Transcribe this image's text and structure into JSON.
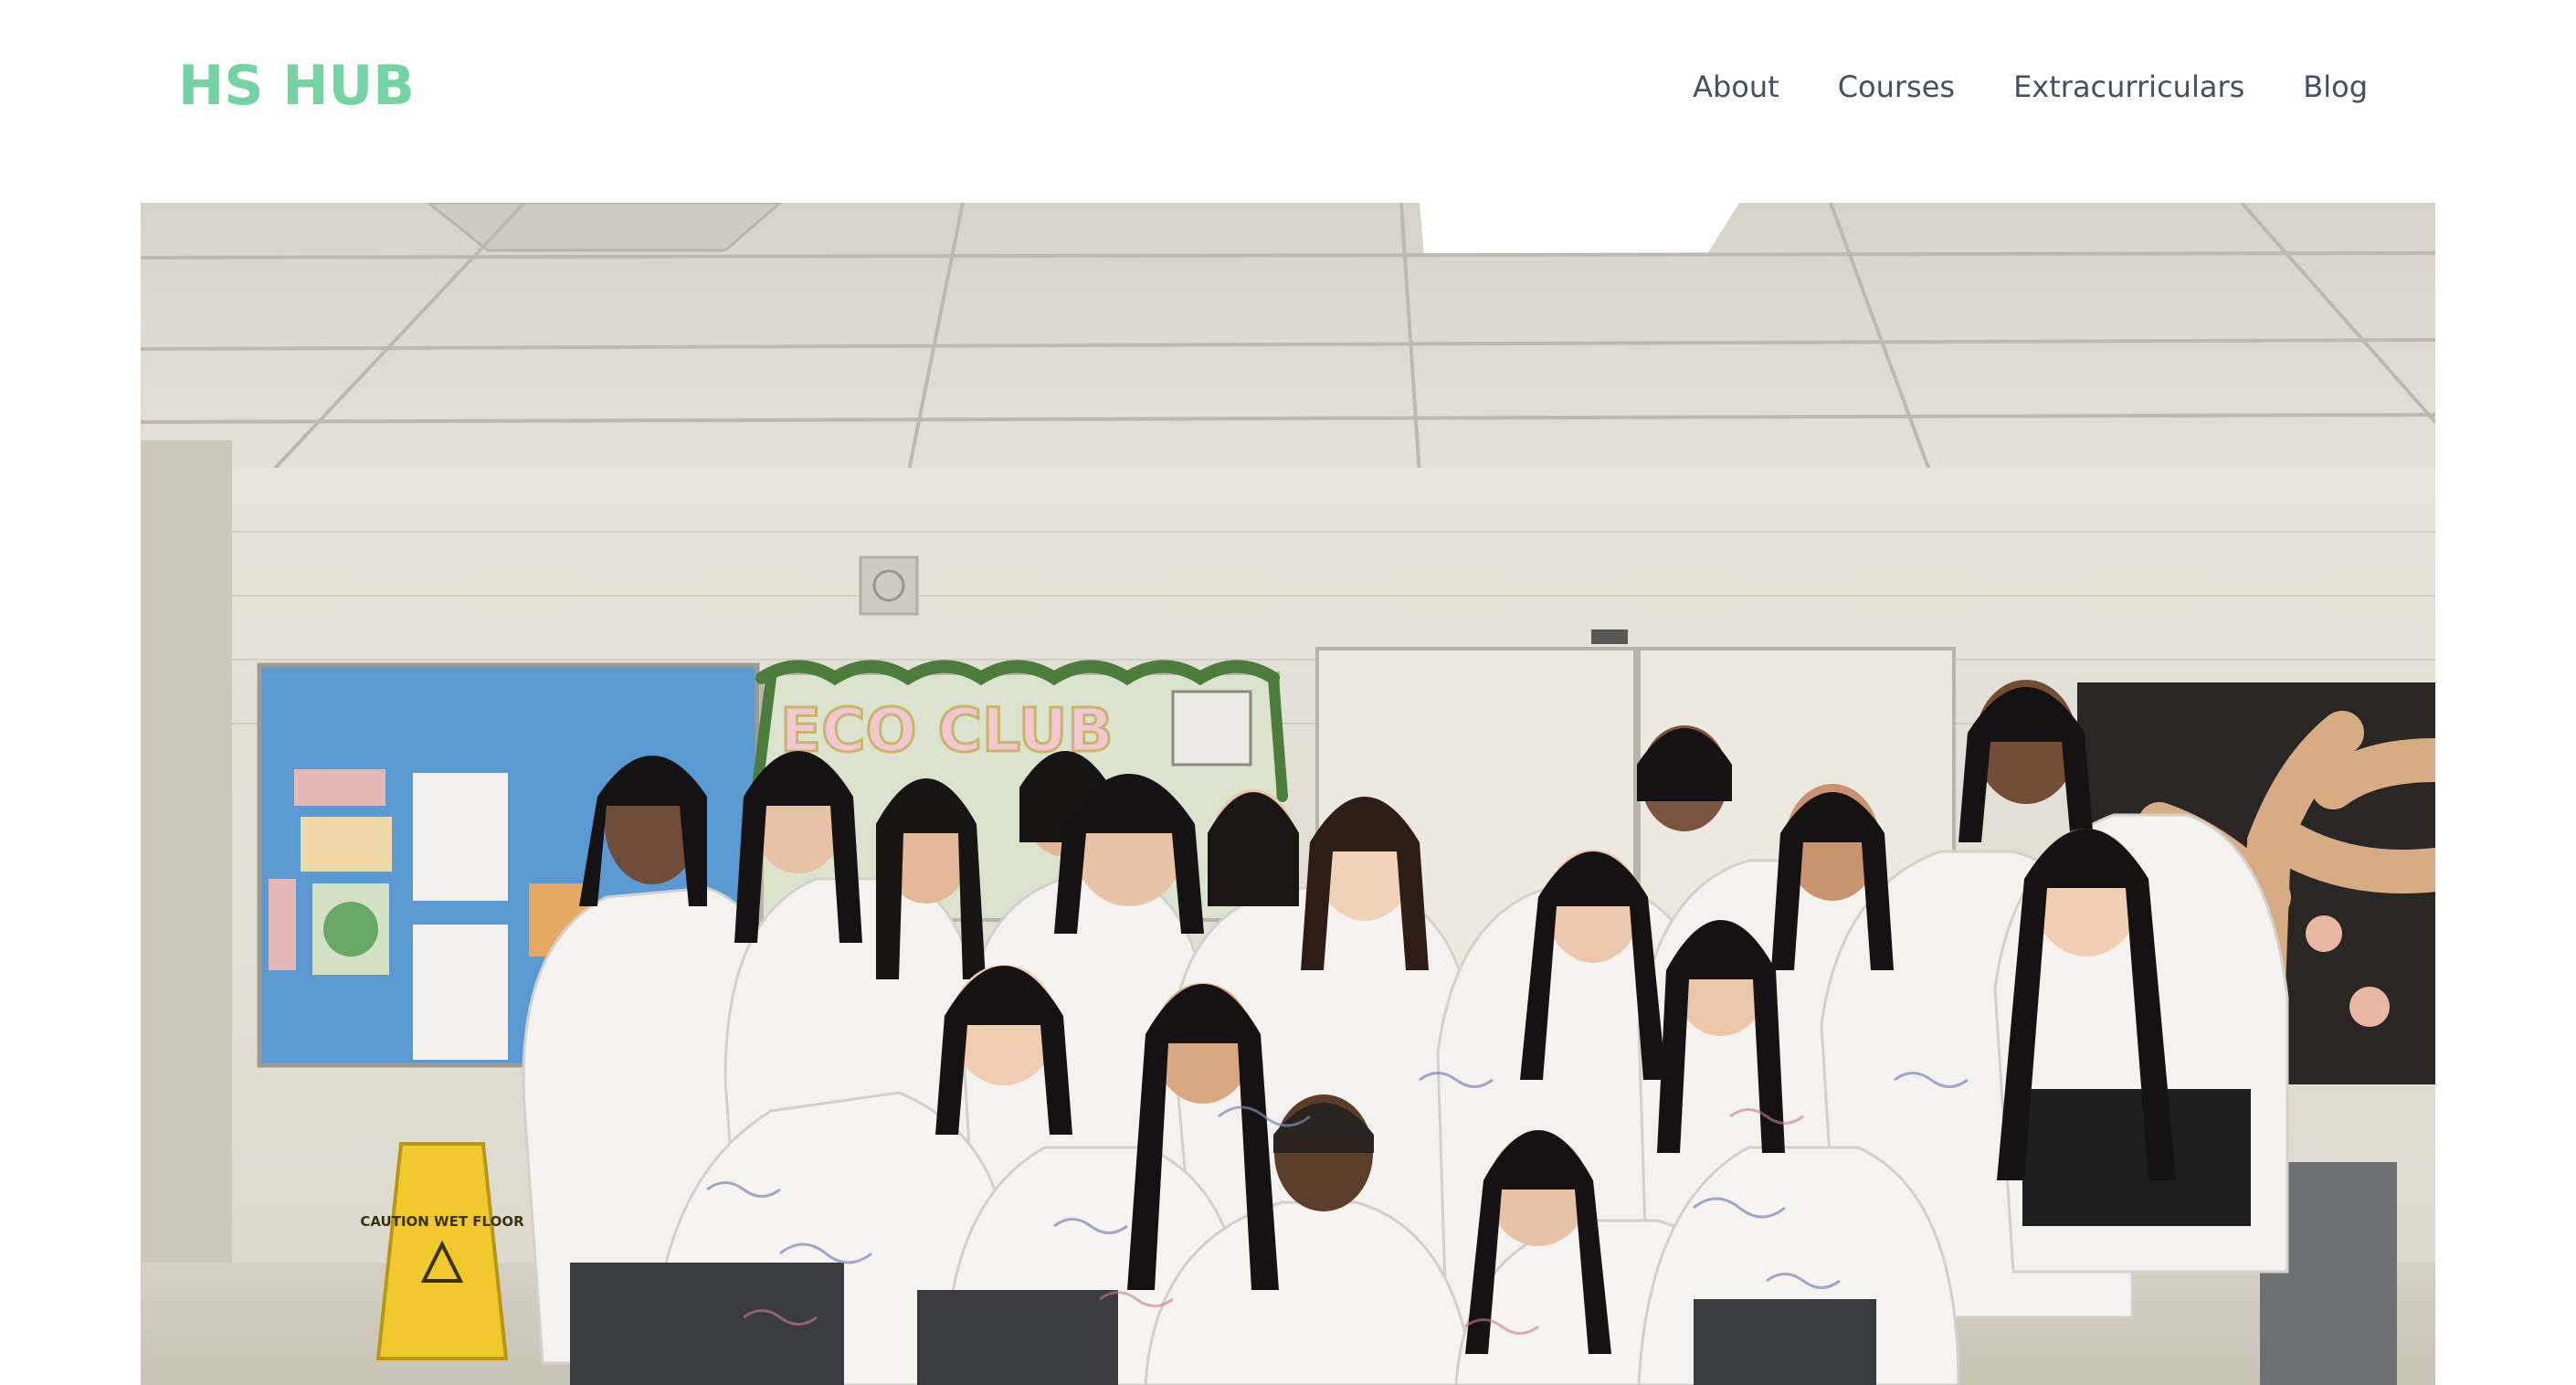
{
  "site": {
    "logo_text": "HS HUB",
    "brand_color": "#74d3a3"
  },
  "nav": {
    "items": [
      {
        "label": "About"
      },
      {
        "label": "Courses"
      },
      {
        "label": "Extracurriculars"
      },
      {
        "label": "Blog"
      }
    ],
    "text_color": "#47505e"
  },
  "hero": {
    "image_subject": "group photo of students in signed white shirts",
    "sign_text": "ECO CLUB",
    "wet_floor_sign_text": "CAUTION WET FLOOR"
  }
}
